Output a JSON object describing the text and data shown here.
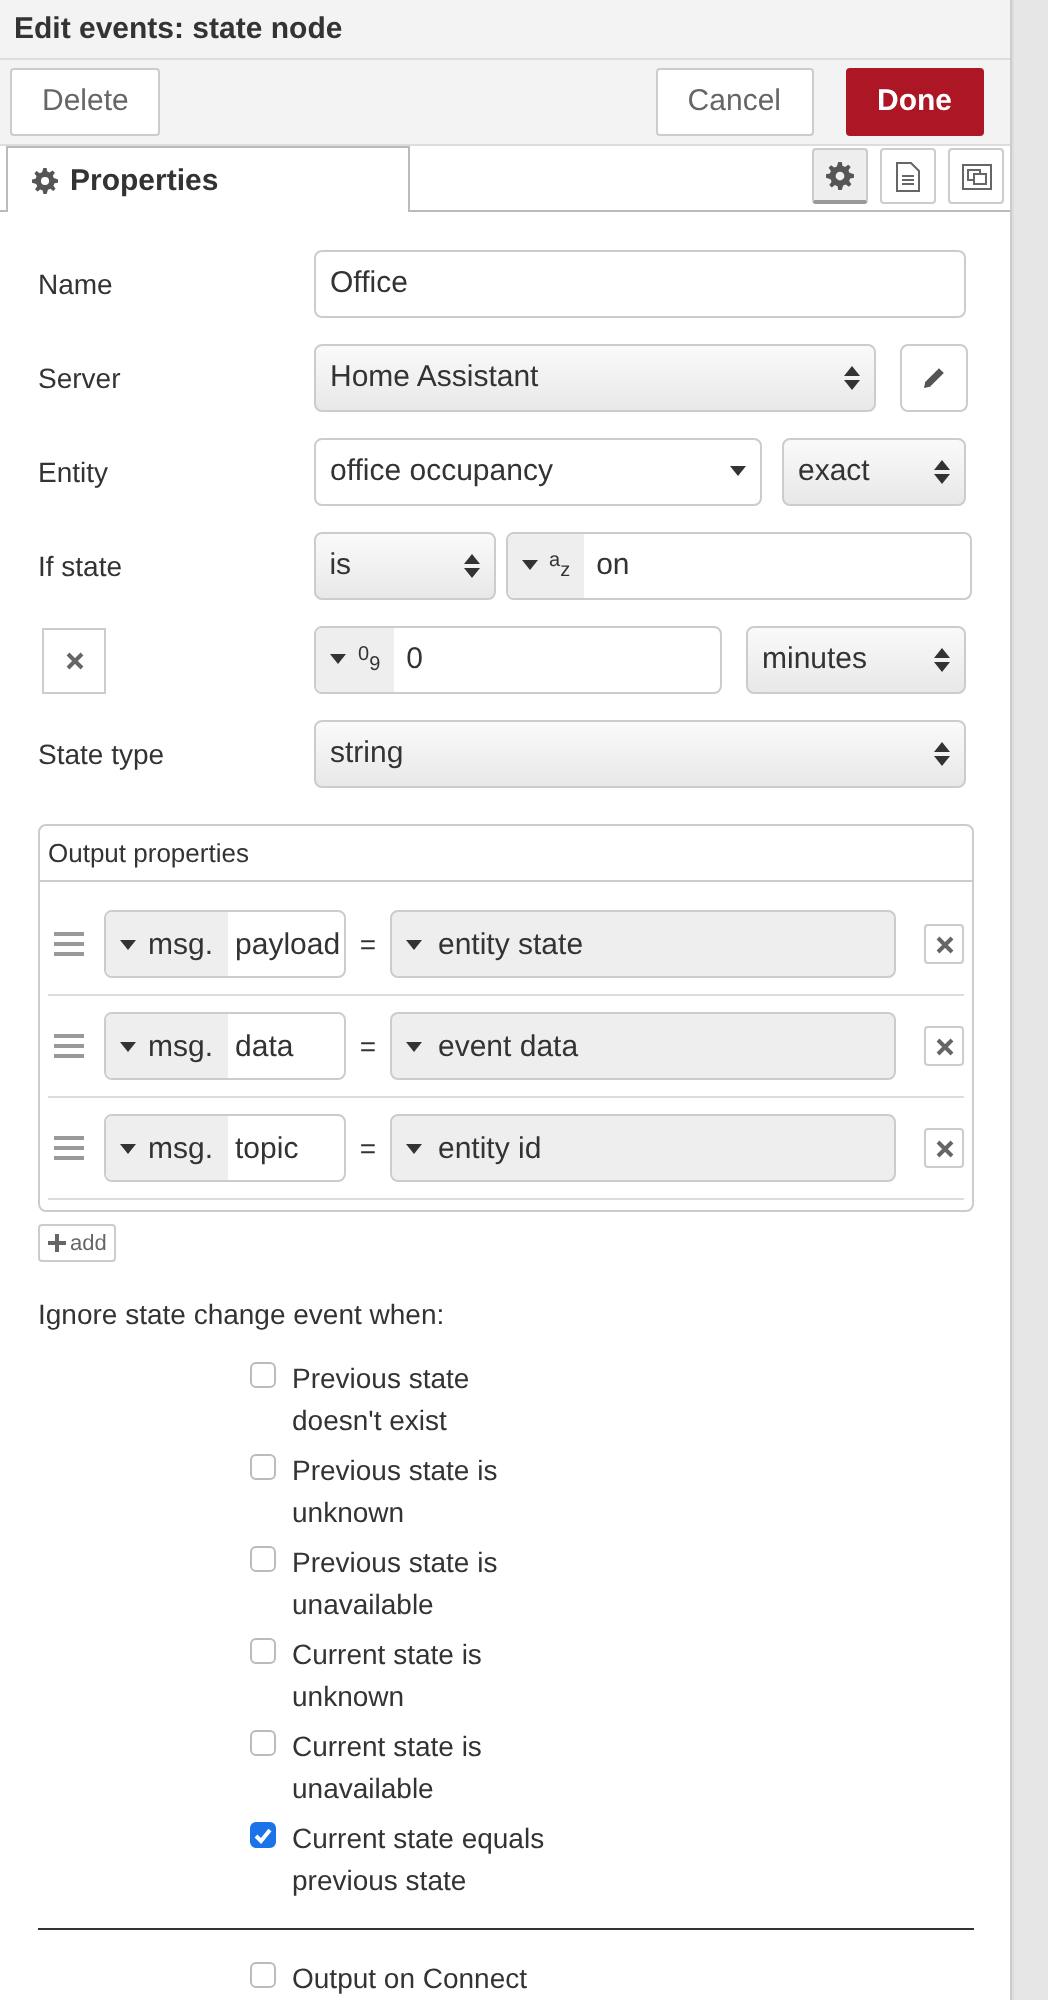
{
  "window": {
    "title": "Edit events: state node"
  },
  "toolbar": {
    "buttons": [
      {
        "label": "Delete",
        "kind": "plain"
      },
      {
        "label": "Cancel",
        "kind": "plain"
      },
      {
        "label": "Done",
        "kind": "primary"
      }
    ]
  },
  "tabs": [
    {
      "label": "Properties",
      "selected": true
    }
  ],
  "tab_icons": [
    {
      "kind": "gear",
      "selected": true
    },
    {
      "kind": "document",
      "selected": false
    },
    {
      "kind": "frame",
      "selected": false
    }
  ],
  "form": [
    {
      "label": "Name",
      "kind": "text",
      "value": "Office"
    },
    {
      "label": "Server",
      "kind": "select-edit",
      "value": "Home Assistant"
    },
    {
      "label": "Entity",
      "kind": "combo",
      "value": "office occupancy",
      "extra": "exact"
    },
    {
      "label": "If state",
      "kind": "compare",
      "operator": "is",
      "type_mark": "az",
      "value": "on"
    },
    {
      "kind": "duration",
      "type_mark": "09",
      "value": "0",
      "unit": "minutes"
    },
    {
      "label": "State type",
      "kind": "select",
      "value": "string"
    }
  ],
  "output_properties": {
    "title": "Output properties",
    "rows": [
      {
        "prefix": "msg.",
        "property": "payload",
        "operator": "=",
        "value": "entity state"
      },
      {
        "prefix": "msg.",
        "property": "data",
        "operator": "=",
        "value": "event data"
      },
      {
        "prefix": "msg.",
        "property": "topic",
        "operator": "=",
        "value": "entity id"
      }
    ],
    "add_label": "add"
  },
  "ignore": {
    "title": "Ignore state change event when:",
    "options": [
      {
        "label": "Previous state doesn't exist",
        "checked": false
      },
      {
        "label": "Previous state is unknown",
        "checked": false
      },
      {
        "label": "Previous state is unavailable",
        "checked": false
      },
      {
        "label": "Current state is unknown",
        "checked": false
      },
      {
        "label": "Current state is unavailable",
        "checked": false
      },
      {
        "label": "Current state equals previous state",
        "checked": true
      }
    ]
  },
  "output_on_connect": {
    "label": "Output on Connect",
    "checked": false
  }
}
